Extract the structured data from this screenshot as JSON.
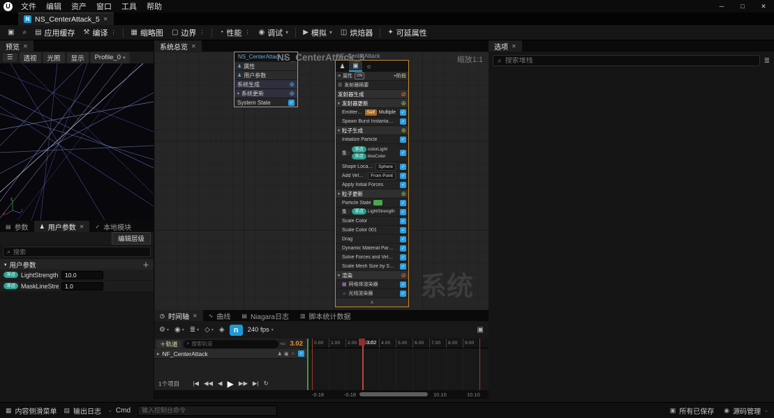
{
  "window_controls": {
    "minimize": "─",
    "maximize": "□",
    "close": "✕"
  },
  "menu_bar": {
    "logo": "U",
    "items": [
      "文件",
      "编辑",
      "资产",
      "窗口",
      "工具",
      "帮助"
    ]
  },
  "asset_tab": {
    "icon": "N",
    "title": "NS_CenterAttack_5",
    "close": "✕"
  },
  "toolbar": {
    "items": [
      {
        "kind": "btn",
        "ico": "▣"
      },
      {
        "kind": "btn",
        "ico": "⌕"
      },
      {
        "kind": "btn",
        "ico": "▤",
        "label": "应用缓存",
        "dim": "dim"
      },
      {
        "kind": "btn",
        "ico": "⚒",
        "label": "编译",
        "aux": "⋮"
      },
      {
        "kind": "sep"
      },
      {
        "kind": "btn",
        "ico": "▦",
        "label": "缩略图"
      },
      {
        "kind": "btn",
        "ico": "▢",
        "label": "边界",
        "aux": "⋮"
      },
      {
        "kind": "sep"
      },
      {
        "kind": "btn",
        "ico": "◔",
        "label": "性能",
        "aux": "⋮"
      },
      {
        "kind": "btn",
        "ico": "◉",
        "label": "调试",
        "aux": "▾"
      },
      {
        "kind": "sep"
      },
      {
        "kind": "btn",
        "ico": "▶",
        "label": "模拟",
        "aux": "▾"
      },
      {
        "kind": "btn",
        "ico": "◫",
        "label": "烘焙器"
      },
      {
        "kind": "sep"
      },
      {
        "kind": "btn",
        "ico": "✦",
        "label": "可延属性"
      }
    ]
  },
  "preview": {
    "tab": "预览",
    "close": "✕",
    "menu_icon": "☰",
    "buttons": [
      {
        "label": "透视"
      },
      {
        "label": "光照"
      },
      {
        "label": "显示"
      },
      {
        "label": "Profile_0",
        "aux": "▾"
      }
    ],
    "axes": {
      "x": "x",
      "y": "y",
      "z": "z"
    }
  },
  "parameters_panel": {
    "tabs": [
      {
        "ico": "▤",
        "label": "参数"
      },
      {
        "ico": "♟",
        "label": "用户参数",
        "close": "✕",
        "active": "on"
      },
      {
        "ico": "✓",
        "label": "本地模块"
      }
    ],
    "edit_button": "编辑层级",
    "search_placeholder": "搜索",
    "section": {
      "label": "用户参数",
      "chev": "▾",
      "add": "＋"
    },
    "rows": [
      {
        "type": "浮点",
        "name": "LightStrength",
        "value": "10.0"
      },
      {
        "type": "浮点",
        "name": "MaskLineStre",
        "value": "1.0"
      }
    ]
  },
  "system_overview": {
    "tab": "系统总览",
    "close": "✕",
    "zoom_label": "缩放1:1",
    "watermark": "系统",
    "ghost_title": "NS_CenterAttack_5",
    "system_node": {
      "title": "NS_CenterAttack_5",
      "rows": [
        {
          "kind": "nprop",
          "ic": "♟",
          "label": "属性"
        },
        {
          "kind": "nprop",
          "ic": "♟",
          "label": "用户参数"
        },
        {
          "kind": "nstage",
          "label": "系统生成",
          "rg": "⊕",
          "rs": "blue"
        },
        {
          "kind": "nstage",
          "chev": "▾",
          "label": "系统更新",
          "rg": "⊕",
          "rs": "blue"
        },
        {
          "kind": "nmod",
          "label": "System State",
          "chk": "on"
        }
      ]
    },
    "emitter_node": {
      "title": "NF_CenterAttack",
      "header_icons": [
        {
          "ico": "♟"
        },
        {
          "ico": "▣",
          "active": "on"
        },
        {
          "ico": "☼"
        }
      ],
      "rows": [
        {
          "kind": "prop",
          "ic": "≡",
          "label": "属性",
          "toggle": "ON",
          "add": "+阶段"
        },
        {
          "kind": "summary",
          "ic": "☰",
          "label": "发射器摘要"
        },
        {
          "kind": "cat",
          "label": "发射器生成",
          "rg": "⊘",
          "rs": "orange"
        },
        {
          "kind": "cat",
          "chev": "▾",
          "label": "发射器更新",
          "rg": "⊕",
          "rs": "green"
        },
        {
          "kind": "mod",
          "label": "Emitter State",
          "b1": "Self",
          "b1s": "orange",
          "b2": "Multiple",
          "b2s": "plain",
          "chk": "on"
        },
        {
          "kind": "mod",
          "label": "Spawn Burst Instantaneous",
          "chk": "on"
        },
        {
          "kind": "cat",
          "chev": "▾",
          "label": "粒子生成",
          "rg": "⊕",
          "rs": "green"
        },
        {
          "kind": "mod",
          "label": "Initialize Particle",
          "chk": "on"
        },
        {
          "kind": "set2",
          "label": "集 :",
          "p1t": "浮点",
          "pill1": "colorLight",
          "p2t": "浮点",
          "pill2": "lineColor",
          "chk": "on"
        },
        {
          "kind": "mod",
          "label": "Shape Location",
          "b1": "Sphere",
          "b1s": "dark",
          "chk": "on"
        },
        {
          "kind": "mod",
          "label": "Add Velocity",
          "b1": "From Point",
          "b1s": "dark",
          "chk": "on"
        },
        {
          "kind": "mod",
          "label": "Apply Initial Forces",
          "chk": "on"
        },
        {
          "kind": "cat",
          "chev": "▾",
          "label": "粒子更新",
          "rg": "⊕",
          "rs": "green"
        },
        {
          "kind": "mod",
          "label": "Particle State",
          "b1": " ",
          "b1s": "green",
          "chk": "on"
        },
        {
          "kind": "set",
          "label": "集 :",
          "p1t": "浮点",
          "pill1": "LightStrength",
          "chk": "on"
        },
        {
          "kind": "mod",
          "label": "Scale Color",
          "chk": "on"
        },
        {
          "kind": "mod",
          "label": "Scale Color 001",
          "chk": "on"
        },
        {
          "kind": "mod",
          "label": "Drag",
          "chk": "on"
        },
        {
          "kind": "mod",
          "label": "Dynamic Material Parameters",
          "chk": "on"
        },
        {
          "kind": "mod",
          "label": "Solve Forces and Velocity",
          "chk": "on"
        },
        {
          "kind": "mod",
          "label": "Scale Mesh Size by Speed",
          "chk": "on"
        },
        {
          "kind": "cat",
          "chev": "▾",
          "label": "渲染",
          "rg": "⊘",
          "rs": "orange"
        },
        {
          "kind": "render",
          "ic": "▦",
          "label": "网格体渲染器",
          "chk": "on"
        },
        {
          "kind": "render",
          "ic": "☼",
          "label": "光线渲染器",
          "chk": "on"
        }
      ],
      "collapse": "∧"
    }
  },
  "selection_panel": {
    "tab": "选项",
    "close": "✕",
    "search_placeholder": "搜索堆栈",
    "filter_icon": "≣"
  },
  "timeline": {
    "tabs": [
      {
        "ico": "◷",
        "label": "时间轴",
        "close": "✕",
        "active": "on"
      },
      {
        "ico": "∿",
        "label": "曲线"
      },
      {
        "ico": "▤",
        "label": "Niagara日志"
      },
      {
        "ico": "▥",
        "label": "脚本统计数据"
      }
    ],
    "toolbar": {
      "icons": [
        {
          "ico": "⚙",
          "aux": "▾"
        },
        {
          "ico": "◉",
          "aux": "▾"
        },
        {
          "ico": "≣",
          "aux": "▾"
        },
        {
          "ico": "◇",
          "aux": "▾"
        },
        {
          "ico": "◈"
        }
      ],
      "niagara_button": "n",
      "fps": "240 fps",
      "fps_aux": "▾",
      "camera_icon": "▣"
    },
    "add_track": "＋轨道",
    "search_placeholder": "搜索轨道",
    "filter_icon": "≔",
    "current_time": "3.02",
    "track": {
      "chev": "▸",
      "name": "NF_CenterAttack",
      "icons": [
        "♟",
        "▣",
        "☼"
      ]
    },
    "item_count": "1个项目",
    "ruler_ticks": [
      "0.00",
      "1.00",
      "2.00",
      "3.00",
      "4.00",
      "5.00",
      "6.00",
      "7.00",
      "8.00",
      "9.00"
    ],
    "playhead_label": "3.02",
    "transport": [
      {
        "g": "|◀"
      },
      {
        "g": "◀◀"
      },
      {
        "g": "◀"
      },
      {
        "g": "▶",
        "big": "big"
      },
      {
        "g": "▶▶"
      },
      {
        "g": "▶|"
      },
      {
        "g": "↻"
      }
    ],
    "range": {
      "outer_start": "-0.18",
      "inner_start": "-0.18",
      "inner_end": "10.10",
      "outer_end": "10.10"
    }
  },
  "status_bar": {
    "content_drawer": {
      "ico": "▦",
      "label": "内容侧滑菜单"
    },
    "output_log": {
      "ico": "▤",
      "label": "输出日志"
    },
    "cmd": {
      "aux": "⌄",
      "label": "Cmd"
    },
    "console_placeholder": "输入控制台命令",
    "saved": {
      "ico": "▣",
      "label": "所有已保存"
    },
    "source": {
      "ico": "◉",
      "label": "源码管理",
      "aux": "⌄"
    }
  }
}
